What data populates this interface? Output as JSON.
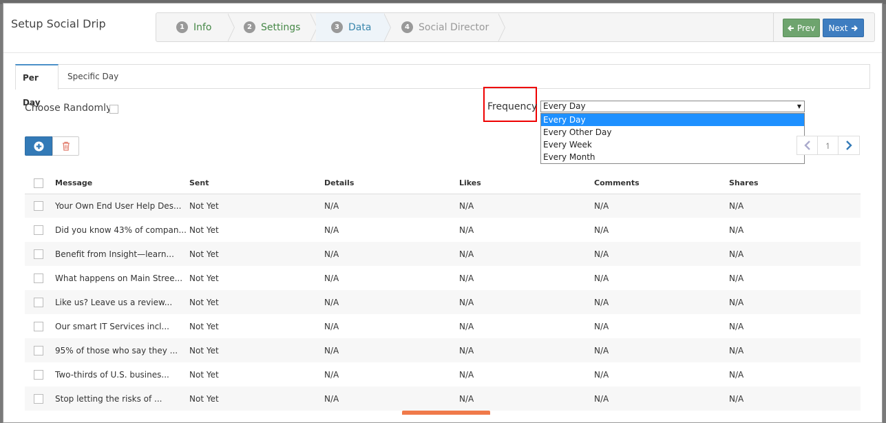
{
  "modal": {
    "title": "Setup Social Drip",
    "steps": [
      {
        "num": "1",
        "label": "Info",
        "state": "done"
      },
      {
        "num": "2",
        "label": "Settings",
        "state": "done"
      },
      {
        "num": "3",
        "label": "Data",
        "state": "active"
      },
      {
        "num": "4",
        "label": "Social Director",
        "state": "todo"
      }
    ],
    "prev_label": "Prev",
    "next_label": "Next"
  },
  "tabs": [
    {
      "label": "Per Day",
      "active": true
    },
    {
      "label": "Specific Day",
      "active": false
    }
  ],
  "choose_randomly_label": "Choose Randomly",
  "frequency": {
    "label": "Frequency",
    "selected": "Every Day",
    "options": [
      "Every Day",
      "Every Other Day",
      "Every Week",
      "Every Month"
    ]
  },
  "pager": {
    "page": "1"
  },
  "table": {
    "headers": [
      "Message",
      "Sent",
      "Details",
      "Likes",
      "Comments",
      "Shares"
    ],
    "rows": [
      [
        "Your Own End User Help Des...",
        "Not Yet",
        "N/A",
        "N/A",
        "N/A",
        "N/A"
      ],
      [
        "Did you know 43% of compan...",
        "Not Yet",
        "N/A",
        "N/A",
        "N/A",
        "N/A"
      ],
      [
        "Benefit from Insight—learn...",
        "Not Yet",
        "N/A",
        "N/A",
        "N/A",
        "N/A"
      ],
      [
        "What happens on Main Stree...",
        "Not Yet",
        "N/A",
        "N/A",
        "N/A",
        "N/A"
      ],
      [
        "Like us? Leave us a review...",
        "Not Yet",
        "N/A",
        "N/A",
        "N/A",
        "N/A"
      ],
      [
        "Our smart IT Services incl...",
        "Not Yet",
        "N/A",
        "N/A",
        "N/A",
        "N/A"
      ],
      [
        "95% of those who say they ...",
        "Not Yet",
        "N/A",
        "N/A",
        "N/A",
        "N/A"
      ],
      [
        "Two-thirds of U.S. busines...",
        "Not Yet",
        "N/A",
        "N/A",
        "N/A",
        "N/A"
      ],
      [
        "Stop letting the risks of ...",
        "Not Yet",
        "N/A",
        "N/A",
        "N/A",
        "N/A"
      ]
    ]
  },
  "colors": {
    "accent": "#337ab7",
    "done_step": "#468847",
    "active_step": "#3a87ad",
    "highlight_box": "#ee0000",
    "selected_option": "#1e90ff"
  },
  "icons": {
    "add": "plus-circle-icon",
    "delete": "trash-icon",
    "prev": "arrow-left-icon",
    "next": "arrow-right-icon",
    "pager_prev": "chevron-left-icon",
    "pager_next": "chevron-right-icon"
  }
}
